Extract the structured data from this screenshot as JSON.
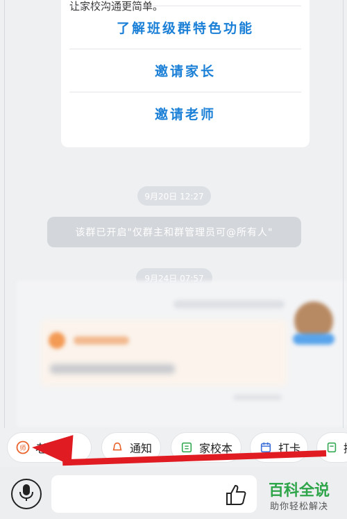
{
  "card": {
    "truncated_top": "让家校沟通更简单。",
    "options": [
      "了解班级群特色功能",
      "邀请家长",
      "邀请老师"
    ]
  },
  "messages": {
    "time1": "9月20日 12:27",
    "notice": "该群已开启\"仅群主和群管理员可@所有人\"",
    "time2": "9月24日 07:57"
  },
  "quickbar": {
    "chips": [
      {
        "label": "老师说",
        "icon": "teacher-badge-icon",
        "color": "#e8622a"
      },
      {
        "label": "通知",
        "icon": "bell-icon",
        "color": "#e8622a"
      },
      {
        "label": "家校本",
        "icon": "notebook-icon",
        "color": "#34a853"
      },
      {
        "label": "打卡",
        "icon": "calendar-icon",
        "color": "#3b6fd8"
      },
      {
        "label": "接龙",
        "icon": "list-icon",
        "color": "#34a853"
      }
    ]
  },
  "input": {
    "placeholder": ""
  },
  "watermark": {
    "title": "百科全说",
    "subtitle": "助你轻松解决"
  },
  "colors": {
    "accent_blue": "#1a7fd6",
    "annotation_red": "#e01b22"
  }
}
